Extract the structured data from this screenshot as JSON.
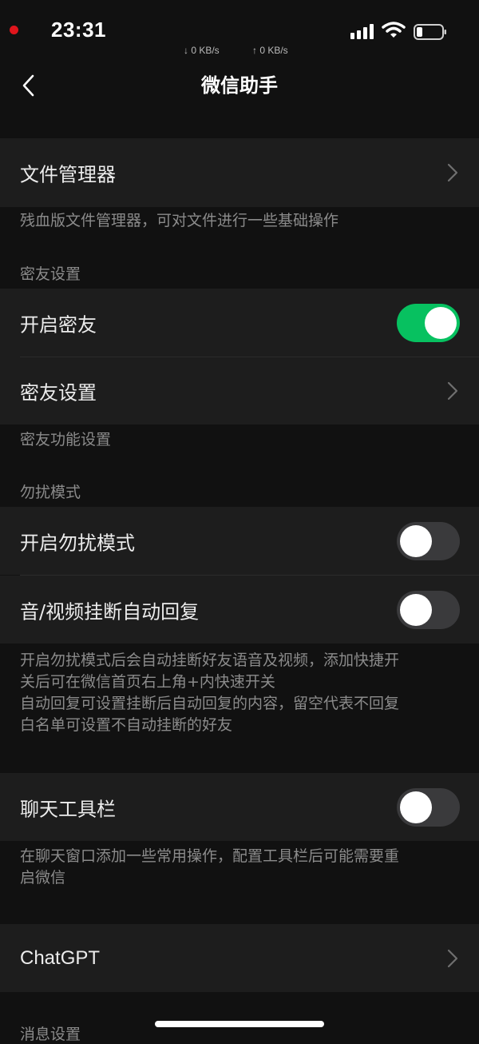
{
  "status_bar": {
    "time": "23:31",
    "download_speed": "↓ 0 KB/s",
    "upload_speed": "↑ 0 KB/s",
    "icons": [
      "recording-dot-icon",
      "cellular-signal-icon",
      "wifi-icon",
      "battery-icon"
    ]
  },
  "nav": {
    "title": "微信助手",
    "back_icon": "chevron-left-icon"
  },
  "items": {
    "file_manager": {
      "label": "文件管理器",
      "note": "残血版文件管理器，可对文件进行一些基础操作"
    },
    "close_friends": {
      "section": "密友设置",
      "enable_label": "开启密友",
      "enable_on": true,
      "settings_label": "密友设置",
      "note": "密友功能设置"
    },
    "dnd": {
      "section": "勿扰模式",
      "enable_label": "开启勿扰模式",
      "enable_on": false,
      "auto_reply_label": "音/视频挂断自动回复",
      "auto_reply_on": false,
      "note_lines": [
        "开启勿扰模式后会自动挂断好友语音及视频，添加快捷开",
        "关后可在微信首页右上角+内快速开关",
        "自动回复可设置挂断后自动回复的内容，留空代表不回复",
        "白名单可设置不自动挂断的好友"
      ]
    },
    "chat_toolbar": {
      "label": "聊天工具栏",
      "on": false,
      "note_lines": [
        "在聊天窗口添加一些常用操作，配置工具栏后可能需要重",
        "启微信"
      ]
    },
    "chatgpt": {
      "label": "ChatGPT"
    },
    "message_settings": {
      "section": "消息设置"
    }
  },
  "colors": {
    "background": "#111111",
    "cell": "#1d1d1d",
    "toggle_on": "#07c160",
    "toggle_off": "#3a3a3c",
    "secondary_text": "#8b8b8b"
  }
}
